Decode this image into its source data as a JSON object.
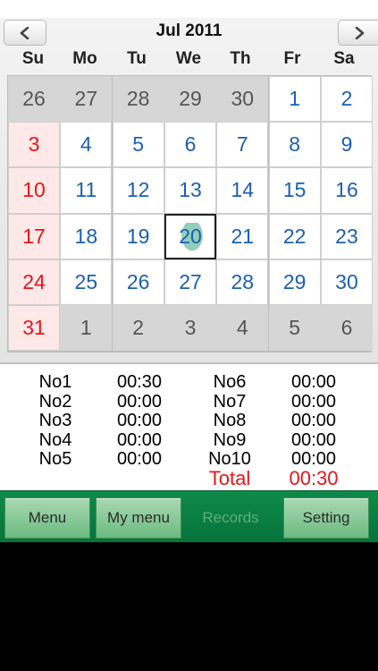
{
  "header": {
    "month_title": "Jul 2011",
    "prev_icon": "chevron-left-icon",
    "next_icon": "chevron-right-icon"
  },
  "weekdays": [
    "Su",
    "Mo",
    "Tu",
    "We",
    "Th",
    "Fr",
    "Sa"
  ],
  "calendar": {
    "selected_day": "20",
    "weeks": [
      [
        {
          "d": "26",
          "t": "other"
        },
        {
          "d": "27",
          "t": "other"
        },
        {
          "d": "28",
          "t": "other"
        },
        {
          "d": "29",
          "t": "other"
        },
        {
          "d": "30",
          "t": "other"
        },
        {
          "d": "1",
          "t": "cur"
        },
        {
          "d": "2",
          "t": "cur"
        }
      ],
      [
        {
          "d": "3",
          "t": "sun"
        },
        {
          "d": "4",
          "t": "cur"
        },
        {
          "d": "5",
          "t": "cur"
        },
        {
          "d": "6",
          "t": "cur"
        },
        {
          "d": "7",
          "t": "cur"
        },
        {
          "d": "8",
          "t": "cur"
        },
        {
          "d": "9",
          "t": "cur"
        }
      ],
      [
        {
          "d": "10",
          "t": "sun"
        },
        {
          "d": "11",
          "t": "cur"
        },
        {
          "d": "12",
          "t": "cur"
        },
        {
          "d": "13",
          "t": "cur"
        },
        {
          "d": "14",
          "t": "cur"
        },
        {
          "d": "15",
          "t": "cur"
        },
        {
          "d": "16",
          "t": "cur"
        }
      ],
      [
        {
          "d": "17",
          "t": "sun"
        },
        {
          "d": "18",
          "t": "cur"
        },
        {
          "d": "19",
          "t": "cur"
        },
        {
          "d": "20",
          "t": "today"
        },
        {
          "d": "21",
          "t": "cur"
        },
        {
          "d": "22",
          "t": "cur"
        },
        {
          "d": "23",
          "t": "cur"
        }
      ],
      [
        {
          "d": "24",
          "t": "sun"
        },
        {
          "d": "25",
          "t": "cur"
        },
        {
          "d": "26",
          "t": "cur"
        },
        {
          "d": "27",
          "t": "cur"
        },
        {
          "d": "28",
          "t": "cur"
        },
        {
          "d": "29",
          "t": "cur"
        },
        {
          "d": "30",
          "t": "cur"
        }
      ],
      [
        {
          "d": "31",
          "t": "sun"
        },
        {
          "d": "1",
          "t": "other"
        },
        {
          "d": "2",
          "t": "other"
        },
        {
          "d": "3",
          "t": "other"
        },
        {
          "d": "4",
          "t": "other"
        },
        {
          "d": "5",
          "t": "other"
        },
        {
          "d": "6",
          "t": "other"
        }
      ]
    ]
  },
  "records": {
    "left": [
      {
        "label": "No1",
        "time": "00:30"
      },
      {
        "label": "No2",
        "time": "00:00"
      },
      {
        "label": "No3",
        "time": "00:00"
      },
      {
        "label": "No4",
        "time": "00:00"
      },
      {
        "label": "No5",
        "time": "00:00"
      }
    ],
    "right": [
      {
        "label": "No6",
        "time": "00:00"
      },
      {
        "label": "No7",
        "time": "00:00"
      },
      {
        "label": "No8",
        "time": "00:00"
      },
      {
        "label": "No9",
        "time": "00:00"
      },
      {
        "label": "No10",
        "time": "00:00"
      }
    ],
    "total_label": "Total",
    "total_time": "00:30"
  },
  "toolbar": {
    "menu": "Menu",
    "my_menu": "My menu",
    "records": "Records",
    "setting": "Setting",
    "active": "records"
  },
  "colors": {
    "weekday_number": "#1a5fb4",
    "sunday": "#e4161b",
    "toolbar_green": "#0f8a4a"
  }
}
